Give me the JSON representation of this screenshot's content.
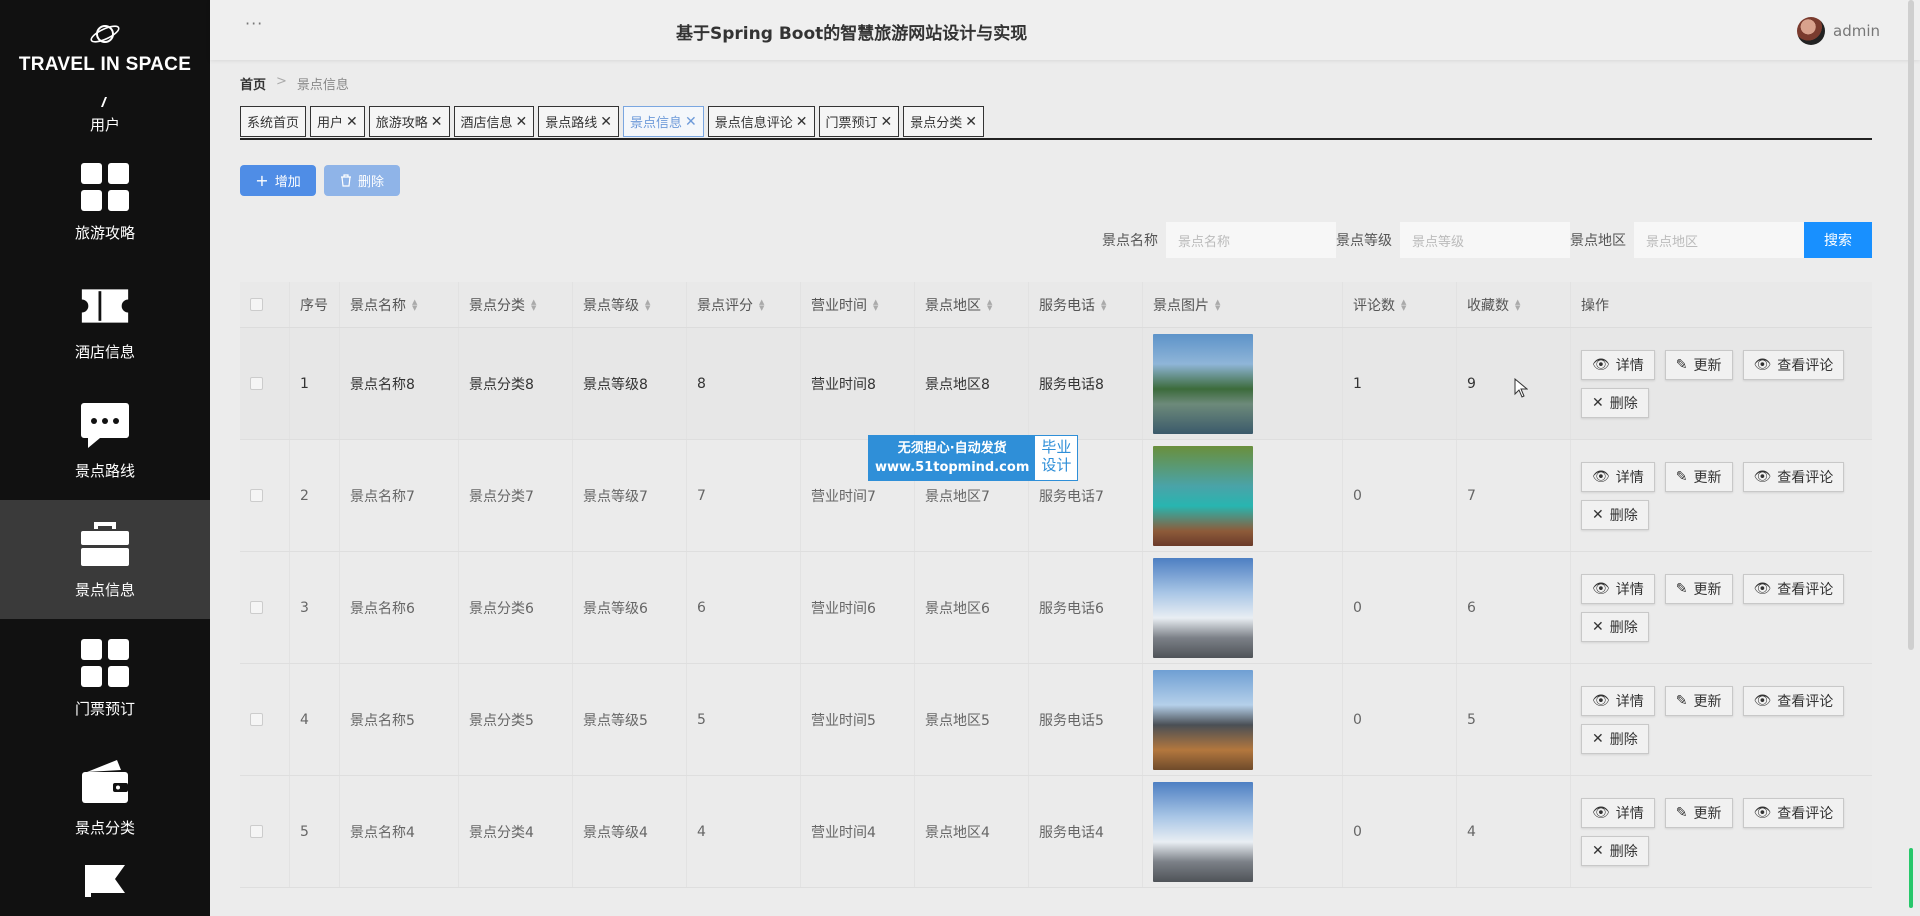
{
  "brand": {
    "title": "TRAVEL IN SPACE"
  },
  "sidebar": {
    "items": [
      {
        "label": "用户",
        "icon": "user-icon"
      },
      {
        "label": "旅游攻略",
        "icon": "grid-icon"
      },
      {
        "label": "酒店信息",
        "icon": "ticket-icon"
      },
      {
        "label": "景点路线",
        "icon": "chat-icon"
      },
      {
        "label": "景点信息",
        "icon": "briefcase-icon",
        "active": true
      },
      {
        "label": "门票预订",
        "icon": "grid-icon"
      },
      {
        "label": "景点分类",
        "icon": "wallet-icon"
      }
    ]
  },
  "topbar": {
    "title": "基于Spring Boot的智慧旅游网站设计与实现",
    "user": "admin"
  },
  "breadcrumb": {
    "home": "首页",
    "sep": ">",
    "current": "景点信息"
  },
  "tabs": [
    {
      "label": "系统首页",
      "closable": false
    },
    {
      "label": "用户",
      "closable": true
    },
    {
      "label": "旅游攻略",
      "closable": true
    },
    {
      "label": "酒店信息",
      "closable": true
    },
    {
      "label": "景点路线",
      "closable": true
    },
    {
      "label": "景点信息",
      "closable": true,
      "active": true
    },
    {
      "label": "景点信息评论",
      "closable": true
    },
    {
      "label": "门票预订",
      "closable": true
    },
    {
      "label": "景点分类",
      "closable": true
    }
  ],
  "actions": {
    "add": "增加",
    "delete": "删除"
  },
  "search": {
    "name_label": "景点名称",
    "name_placeholder": "景点名称",
    "level_label": "景点等级",
    "level_placeholder": "景点等级",
    "region_label": "景点地区",
    "region_placeholder": "景点地区",
    "button": "搜索"
  },
  "table": {
    "headers": [
      "序号",
      "景点名称",
      "景点分类",
      "景点等级",
      "景点评分",
      "营业时间",
      "景点地区",
      "服务电话",
      "景点图片",
      "评论数",
      "收藏数",
      "操作"
    ],
    "rows": [
      {
        "no": "1",
        "name": "景点名称8",
        "category": "景点分类8",
        "level": "景点等级8",
        "score": "8",
        "hours": "营业时间8",
        "region": "景点地区8",
        "phone": "服务电话8",
        "comments": "1",
        "favorites": "9"
      },
      {
        "no": "2",
        "name": "景点名称7",
        "category": "景点分类7",
        "level": "景点等级7",
        "score": "7",
        "hours": "营业时间7",
        "region": "景点地区7",
        "phone": "服务电话7",
        "comments": "0",
        "favorites": "7"
      },
      {
        "no": "3",
        "name": "景点名称6",
        "category": "景点分类6",
        "level": "景点等级6",
        "score": "6",
        "hours": "营业时间6",
        "region": "景点地区6",
        "phone": "服务电话6",
        "comments": "0",
        "favorites": "6"
      },
      {
        "no": "4",
        "name": "景点名称5",
        "category": "景点分类5",
        "level": "景点等级5",
        "score": "5",
        "hours": "营业时间5",
        "region": "景点地区5",
        "phone": "服务电话5",
        "comments": "0",
        "favorites": "5"
      },
      {
        "no": "5",
        "name": "景点名称4",
        "category": "景点分类4",
        "level": "景点等级4",
        "score": "4",
        "hours": "营业时间4",
        "region": "景点地区4",
        "phone": "服务电话4",
        "comments": "0",
        "favorites": "4"
      }
    ],
    "row_actions": {
      "detail": "详情",
      "update": "更新",
      "view_comments": "查看评论",
      "delete": "删除"
    }
  },
  "watermark": {
    "line1": "无须担心·自动发货",
    "line2": "www.51topmind.com",
    "badge1": "毕业",
    "badge2": "设计"
  },
  "colors": {
    "sidebar_bg": "#111111",
    "primary": "#1890ff",
    "add_button": "#4f8de6",
    "delete_button": "#8fb4e8"
  }
}
